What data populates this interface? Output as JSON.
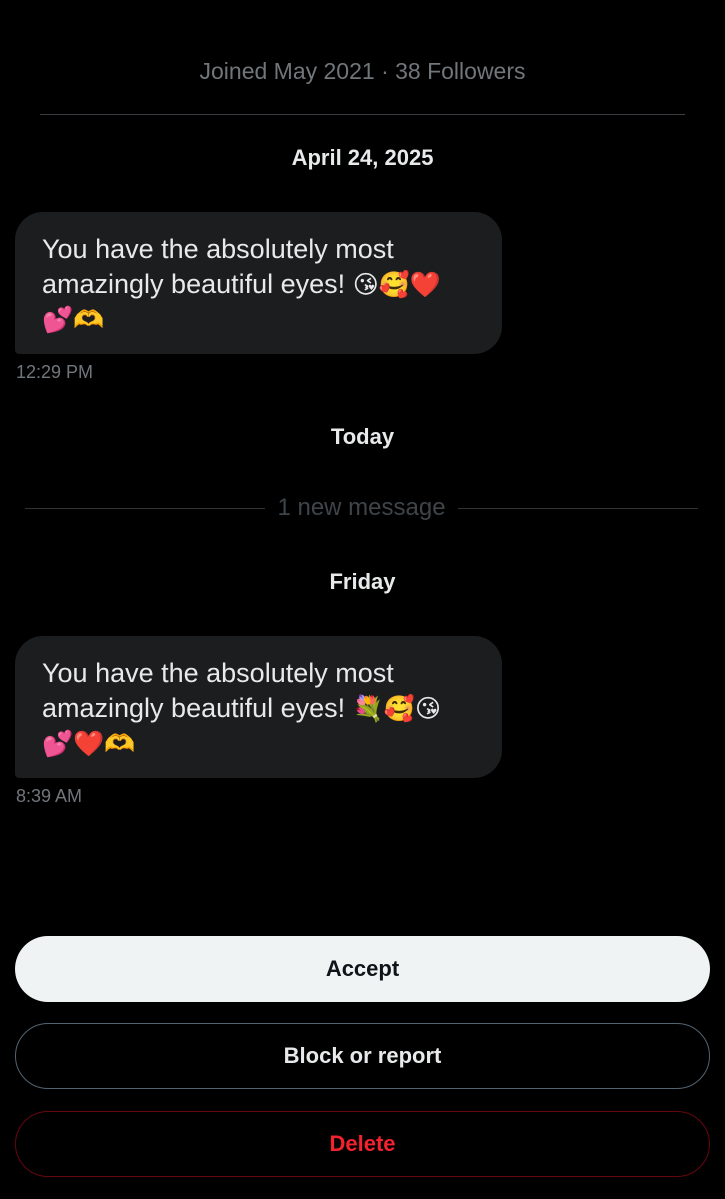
{
  "profile": {
    "meta": "Joined May 2021 · 38 Followers"
  },
  "conversation": {
    "groups": [
      {
        "date_label": "April 24, 2025",
        "message": {
          "text_line1": "You have the absolutely most",
          "text_line2": "amazingly beautiful eyes!",
          "emojis_line2": "😘🥰❤️",
          "emojis_line3": "💕🫶",
          "time": "12:29 PM"
        }
      },
      {
        "date_label": "Today"
      },
      {
        "date_label": "Friday",
        "message": {
          "text_line1": "You have the absolutely most",
          "text_line2": "amazingly beautiful eyes!",
          "emojis_line2": "💐🥰😘",
          "emojis_line3": "💕❤️🫶",
          "time": "8:39 AM"
        }
      }
    ],
    "new_message_divider": "1 new message"
  },
  "actions": {
    "accept_label": "Accept",
    "block_label": "Block or report",
    "delete_label": "Delete"
  },
  "colors": {
    "background": "#000000",
    "bubble": "#1c1d1f",
    "accept_bg": "#eff3f4",
    "delete_red": "#f4212e",
    "muted_text": "#71767b"
  }
}
